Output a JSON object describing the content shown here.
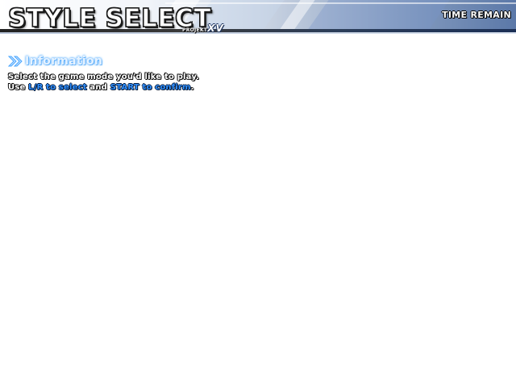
{
  "header": {
    "title": "STYLE SELECT",
    "brand_small": "PROJEKT",
    "brand_big": "XV",
    "time_label": "TIME REMAIN"
  },
  "info": {
    "heading_icon": "double-chevron-icon",
    "heading": "Information",
    "line1": "Select the game mode you'd like to play.",
    "line2_a": "Use ",
    "line2_b": "L/R to select",
    "line2_c": " and ",
    "line2_d": "START to confirm",
    "line2_e": "."
  },
  "colors": {
    "highlight": "#2f8fff",
    "heading_glow": "#4aa6ff",
    "header_accent": "#5b78a8"
  }
}
